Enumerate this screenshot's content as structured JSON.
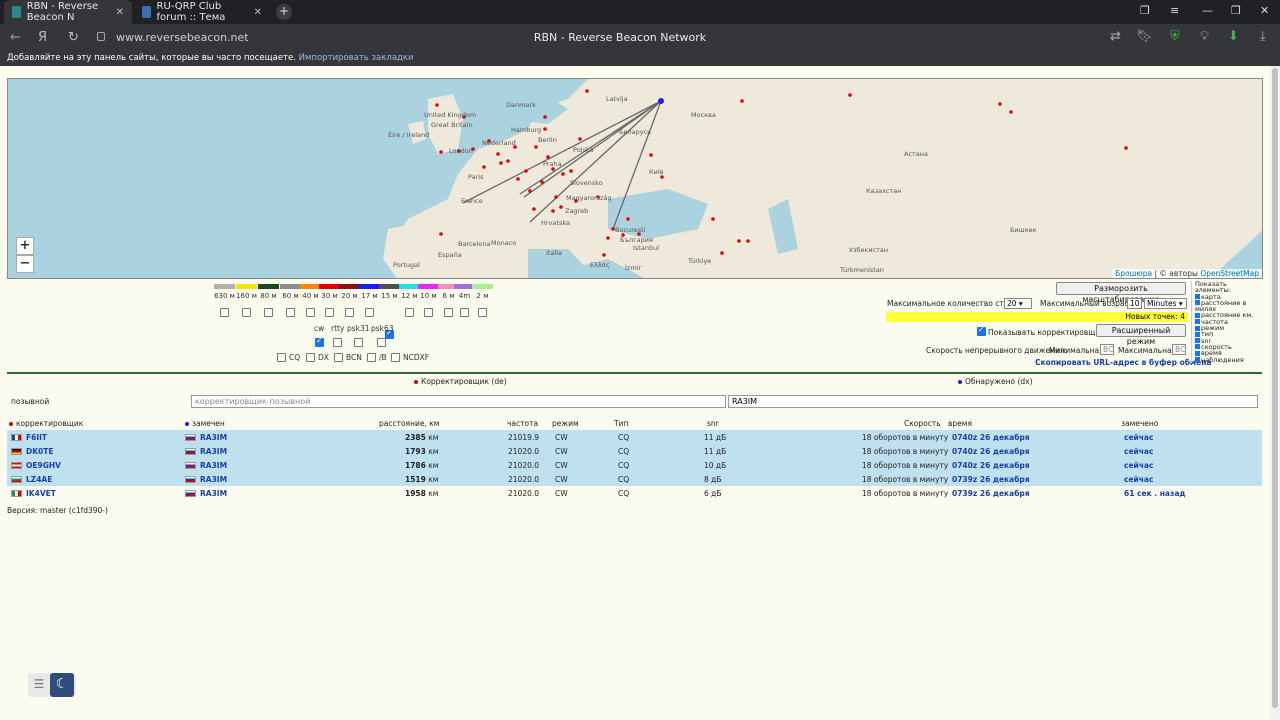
{
  "browser": {
    "tabs": [
      {
        "title": "RBN - Reverse Beacon N",
        "active": true
      },
      {
        "title": "RU-QRP Club forum :: Тема",
        "active": false
      }
    ],
    "url": "www.reversebeacon.net",
    "page_title": "RBN - Reverse Beacon Network",
    "bookmark_hint": "Добавляйте на эту панель сайты, которые вы часто посещаете.",
    "bookmark_import": "Импортировать закладки"
  },
  "map": {
    "labels": [
      "Latvija",
      "Москва",
      "Danmark",
      "United Kingdom",
      "Great Britain",
      "Éire / Ireland",
      "Hamburg",
      "Berlin",
      "Беларусь",
      "London",
      "Nederland",
      "Polska",
      "Praha",
      "Київ",
      "Paris",
      "France",
      "Slovensko",
      "Magyarország",
      "Zagreb",
      "Hrvatska",
      "București",
      "България",
      "Barcelona",
      "España",
      "Portugal",
      "Italia",
      "Istanbul",
      "Türkiye",
      "Астана",
      "Казахстан",
      "Бишкек",
      "Узбекистан",
      "Türkmenistan",
      "Monaco",
      "Ελλάς",
      "İzmir"
    ],
    "zoom_in": "+",
    "zoom_out": "−",
    "attribution_link": "Брошюра",
    "attribution_sep": "| © авторы",
    "attribution_osm": "OpenStreetMap"
  },
  "bands": [
    {
      "label": "630 м",
      "color": "#b0b0b0",
      "checked": false
    },
    {
      "label": "160 м",
      "color": "#f5e400",
      "checked": false
    },
    {
      "label": "80 м",
      "color": "#1b4a14",
      "checked": false
    },
    {
      "label": "60 м",
      "color": "#8c8c8c",
      "checked": false
    },
    {
      "label": "40 м",
      "color": "#f58a00",
      "checked": false
    },
    {
      "label": "30 м",
      "color": "#e00000",
      "checked": false
    },
    {
      "label": "20 м",
      "color": "#8b1010",
      "checked": false
    },
    {
      "label": "17 м",
      "color": "#1a1aff",
      "checked": false
    },
    {
      "label": "15 м",
      "color": "#505050",
      "checked": true
    },
    {
      "label": "12 м",
      "color": "#20e0e0",
      "checked": false
    },
    {
      "label": "10 м",
      "color": "#ff20ff",
      "checked": false
    },
    {
      "label": "6 м",
      "color": "#ff8cc0",
      "checked": false
    },
    {
      "label": "4m",
      "color": "#a070e0",
      "checked": false
    },
    {
      "label": "2 м",
      "color": "#a8f090",
      "checked": false
    }
  ],
  "modes": [
    {
      "label": "cw",
      "checked": true
    },
    {
      "label": "rtty",
      "checked": false
    },
    {
      "label": "psk31",
      "checked": false
    },
    {
      "label": "psk63",
      "checked": false
    }
  ],
  "types": [
    {
      "label": "CQ",
      "checked": false
    },
    {
      "label": "DX",
      "checked": false
    },
    {
      "label": "BCN",
      "checked": false
    },
    {
      "label": "/B",
      "checked": false
    },
    {
      "label": "NCDXF",
      "checked": false
    }
  ],
  "controls": {
    "unfreeze_button": "Разморозить масштабирование",
    "max_rows_label": "Максимальное количество строк",
    "max_rows_value": "20",
    "max_age_label": "Максимальный возраст",
    "max_age_value": "10",
    "max_age_unit": "Minutes",
    "new_points": "Новых точек: 4",
    "show_skimmers_label": "Показывать корректировщиков",
    "show_skimmers_checked": true,
    "advanced_button": "Расширенный режим",
    "speed_label": "Скорость непрерывного движения:",
    "speed_min_label": "Минимальная",
    "speed_min_placeholder": "ВС",
    "speed_max_label": "Максимальная",
    "speed_max_placeholder": "ВС",
    "copy_url": "Скопировать URL-адрес в буфер обмена"
  },
  "elements_panel": {
    "title": "Показать элементы:",
    "items": [
      "карта",
      "расстояние в милях",
      "расстояние км.",
      "частота",
      "режим",
      "тип",
      "snr",
      "скорость",
      "время",
      "наблюдения"
    ]
  },
  "filters": {
    "de_header": "Корректировщик (de)",
    "dx_header": "Обнаружено (dx)",
    "row_label": "позывной",
    "de_placeholder": "корректировщик-позывной",
    "dx_value": "RA3IM"
  },
  "table": {
    "headers": {
      "spotter": "корректировщик",
      "spotted": "замечен",
      "distance": "расстояние, км",
      "freq": "частота",
      "mode": "режим",
      "type": "Тип",
      "snr": "snr",
      "speed": "Скорость",
      "time": "время",
      "seen": "замечено"
    },
    "rows": [
      {
        "spotter": "F6IIT",
        "flag": "fr",
        "spotted": "RA3IM",
        "distance": "2385",
        "unit": "км",
        "freq": "21019.9",
        "mode": "CW",
        "type": "CQ",
        "snr": "11 дБ",
        "speed": "18 оборотов в минуту",
        "time": "0740z 26 декабря",
        "seen": "сейчас",
        "hl": true
      },
      {
        "spotter": "DK0TE",
        "flag": "de",
        "spotted": "RA3IM",
        "distance": "1793",
        "unit": "км",
        "freq": "21020.0",
        "mode": "CW",
        "type": "CQ",
        "snr": "11 дБ",
        "speed": "18 оборотов в минуту",
        "time": "0740z 26 декабря",
        "seen": "сейчас",
        "hl": true
      },
      {
        "spotter": "OE9GHV",
        "flag": "at",
        "spotted": "RA3IM",
        "distance": "1786",
        "unit": "км",
        "freq": "21020.0",
        "mode": "CW",
        "type": "CQ",
        "snr": "10 дБ",
        "speed": "18 оборотов в минуту",
        "time": "0740z 26 декабря",
        "seen": "сейчас",
        "hl": true
      },
      {
        "spotter": "LZ4AE",
        "flag": "bg",
        "spotted": "RA3IM",
        "distance": "1519",
        "unit": "км",
        "freq": "21020.0",
        "mode": "CW",
        "type": "CQ",
        "snr": "8 дБ",
        "speed": "18 оборотов в минуту",
        "time": "0739z 26 декабря",
        "seen": "сейчас",
        "hl": true
      },
      {
        "spotter": "IK4VET",
        "flag": "it",
        "spotted": "RA3IM",
        "distance": "1958",
        "unit": "км",
        "freq": "21020.0",
        "mode": "CW",
        "type": "CQ",
        "snr": "6 дБ",
        "speed": "18 оборотов в минуту",
        "time": "0739z 26 декабря",
        "seen": "61 сек . назад",
        "hl": false
      }
    ]
  },
  "version": "Версия: master (c1fd390-)"
}
